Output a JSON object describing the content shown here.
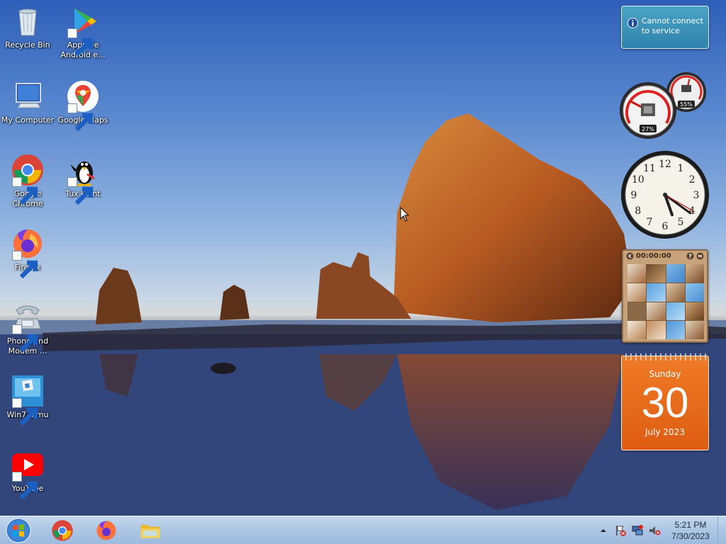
{
  "desktop": {
    "icons": [
      {
        "name": "recycle-bin",
        "label": "Recycle Bin",
        "icon": "recycle-bin-icon"
      },
      {
        "name": "apps-de-android",
        "label": "Apps de\nAndroid e...",
        "icon": "google-play-icon"
      },
      {
        "name": "my-computer",
        "label": "My Computer",
        "icon": "computer-icon"
      },
      {
        "name": "google-maps",
        "label": "Google Maps",
        "icon": "google-maps-icon"
      },
      {
        "name": "google-chrome",
        "label": "Google\nChrome",
        "icon": "chrome-icon"
      },
      {
        "name": "tux-paint",
        "label": "Tux Paint",
        "icon": "tux-penguin-icon"
      },
      {
        "name": "firefox",
        "label": "Firefox",
        "icon": "firefox-icon"
      },
      {
        "name": "phone-and-modem",
        "label": "Phone and\nModem ...",
        "icon": "telephone-icon"
      },
      {
        "name": "win7-simu",
        "label": "Win7 Simu",
        "icon": "win7-simu-icon"
      },
      {
        "name": "youtube",
        "label": "YouTube",
        "icon": "youtube-icon"
      }
    ]
  },
  "gadgets": {
    "notification": {
      "line1": "Cannot connect",
      "line2": "to service"
    },
    "cpu_meter": {
      "cpu_label": "27%",
      "cpu_value": 27,
      "memory_label": "55%",
      "memory_value": 55
    },
    "clock": {
      "hour": 5,
      "minute": 21,
      "second": 20,
      "numerals": [
        "12",
        "1",
        "2",
        "3",
        "4",
        "5",
        "6",
        "7",
        "8",
        "9",
        "10",
        "11"
      ]
    },
    "puzzle": {
      "timer": "00:00:00"
    },
    "calendar": {
      "weekday": "Sunday",
      "day": "30",
      "month_year": "July 2023"
    }
  },
  "taskbar": {
    "time": "5:21 PM",
    "date": "7/30/2023",
    "pinned": [
      "chrome-icon",
      "firefox-icon",
      "file-explorer-icon"
    ]
  },
  "colors": {
    "taskbar_top": "#c5d8ee",
    "calendar_orange": "#e86a1c",
    "notify_blue": "#3b93bb"
  }
}
